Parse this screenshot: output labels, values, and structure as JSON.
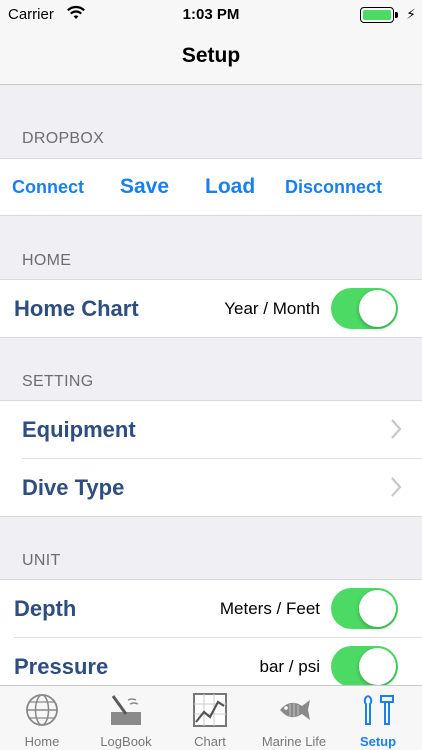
{
  "status": {
    "carrier": "Carrier",
    "time": "1:03 PM"
  },
  "nav": {
    "title": "Setup"
  },
  "dropbox": {
    "header": "DROPBOX",
    "connect": "Connect",
    "save": "Save",
    "load": "Load",
    "disconnect": "Disconnect"
  },
  "home": {
    "header": "HOME",
    "home_chart": {
      "label": "Home Chart",
      "value": "Year / Month",
      "on": true
    }
  },
  "setting": {
    "header": "SETTING",
    "equipment": "Equipment",
    "dive_type": "Dive Type"
  },
  "unit": {
    "header": "UNIT",
    "depth": {
      "label": "Depth",
      "value": "Meters / Feet",
      "on": true
    },
    "pressure": {
      "label": "Pressure",
      "value": "bar / psi",
      "on": true
    }
  },
  "tabs": [
    {
      "label": "Home",
      "icon": "globe-icon"
    },
    {
      "label": "LogBook",
      "icon": "logbook-icon"
    },
    {
      "label": "Chart",
      "icon": "chart-icon"
    },
    {
      "label": "Marine Life",
      "icon": "fish-icon"
    },
    {
      "label": "Setup",
      "icon": "tools-icon",
      "active": true
    }
  ],
  "colors": {
    "accent": "#1a7ff0",
    "title": "#2d4e7e",
    "toggle_on": "#4cd964"
  }
}
